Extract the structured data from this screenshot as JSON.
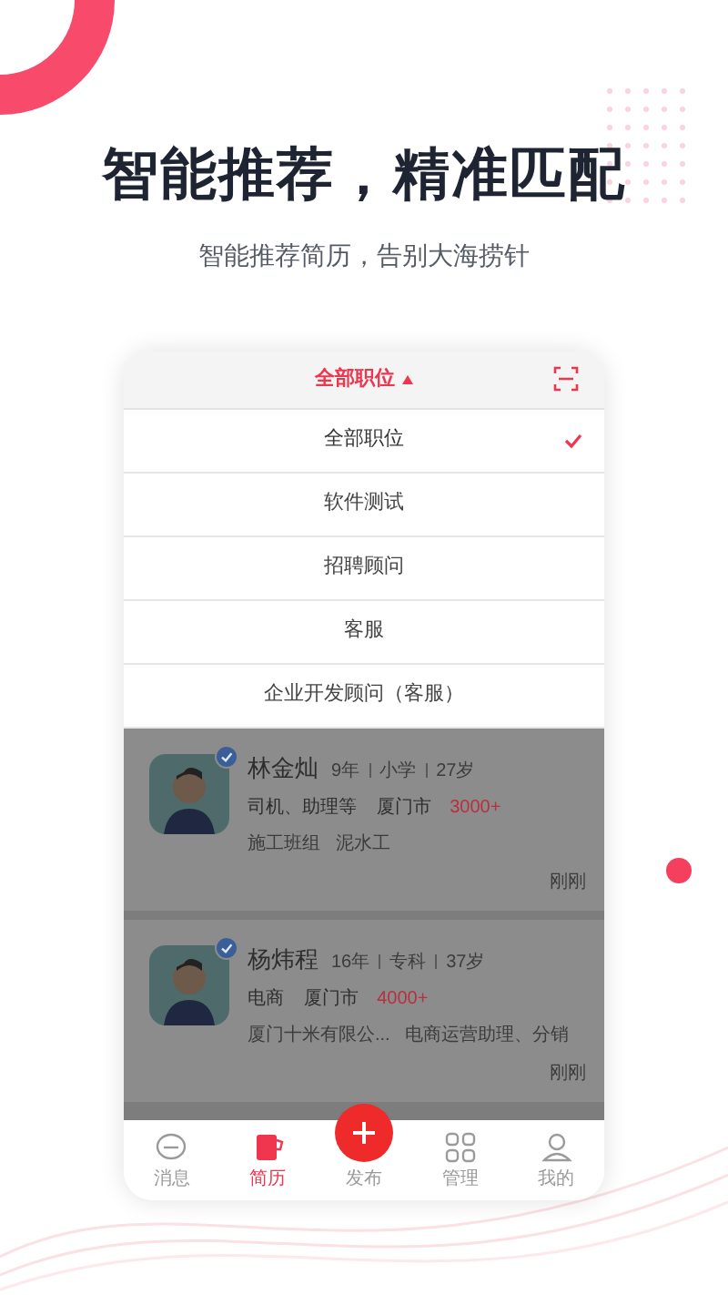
{
  "headline": "智能推荐，精准匹配",
  "subheadline": "智能推荐简历，告别大海捞针",
  "app": {
    "filter": {
      "label": "全部职位",
      "expanded": true
    },
    "options": [
      {
        "label": "全部职位",
        "selected": true
      },
      {
        "label": "软件测试",
        "selected": false
      },
      {
        "label": "招聘顾问",
        "selected": false
      },
      {
        "label": "客服",
        "selected": false
      },
      {
        "label": "企业开发顾问（客服）",
        "selected": false
      }
    ],
    "candidates": [
      {
        "name": "林金灿",
        "meta": [
          "9年",
          "小学",
          "27岁"
        ],
        "tags": [
          "司机、助理等",
          "厦门市"
        ],
        "salary": "3000+",
        "experience": [
          "施工班组",
          "泥水工"
        ],
        "time": "刚刚",
        "verified": true
      },
      {
        "name": "杨炜程",
        "meta": [
          "16年",
          "专科",
          "37岁"
        ],
        "tags": [
          "电商",
          "厦门市"
        ],
        "salary": "4000+",
        "experience": [
          "厦门十米有限公...",
          "电商运营助理、分销"
        ],
        "time": "刚刚",
        "verified": true
      }
    ],
    "tabs": [
      {
        "label": "消息",
        "kind": "chat",
        "selected": false
      },
      {
        "label": "简历",
        "kind": "resume",
        "selected": true
      },
      {
        "label": "发布",
        "kind": "publish",
        "selected": false
      },
      {
        "label": "管理",
        "kind": "grid",
        "selected": false
      },
      {
        "label": "我的",
        "kind": "person",
        "selected": false
      }
    ]
  }
}
